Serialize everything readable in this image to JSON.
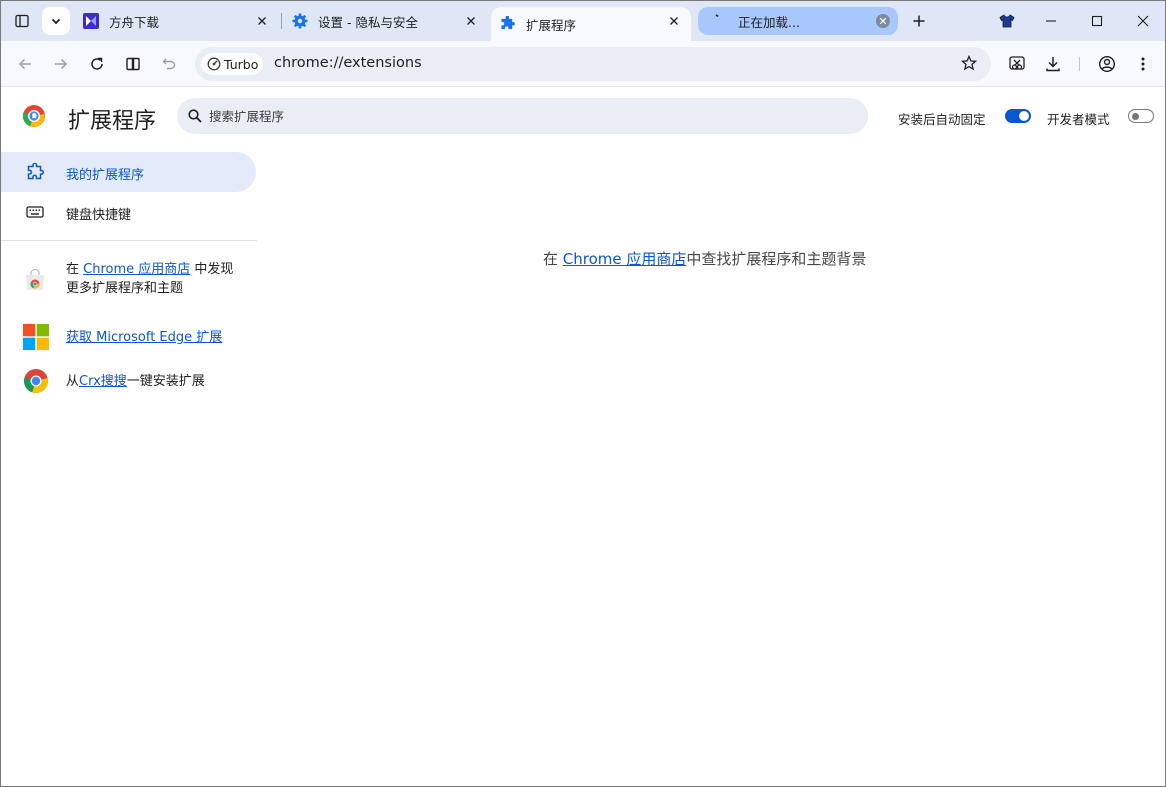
{
  "tabs": [
    {
      "title": "方舟下载",
      "icon": "fangzhou-icon",
      "active": false
    },
    {
      "title": "设置 - 隐私与安全",
      "icon": "gear-icon",
      "active": false
    },
    {
      "title": "扩展程序",
      "icon": "puzzle-icon",
      "active": true
    },
    {
      "title": "正在加载...",
      "icon": "loading-icon",
      "active": false,
      "loading": true
    }
  ],
  "toolbar": {
    "turbo_label": "Turbo",
    "url": "chrome://extensions"
  },
  "page": {
    "title": "扩展程序",
    "search_placeholder": "搜索扩展程序",
    "auto_pin_label": "安装后自动固定",
    "auto_pin_on": true,
    "dev_mode_label": "开发者模式",
    "dev_mode_on": false
  },
  "sidebar": {
    "items": [
      {
        "label": "我的扩展程序",
        "icon": "puzzle-outline-icon",
        "selected": true
      },
      {
        "label": "键盘快捷键",
        "icon": "keyboard-icon",
        "selected": false
      }
    ],
    "store_prefix": "在 ",
    "store_link": "Chrome 应用商店",
    "store_suffix": " 中发现更多扩展程序和主题",
    "edge_link": "获取 Microsoft Edge 扩展",
    "crx_prefix": "从",
    "crx_link": "Crx搜搜",
    "crx_suffix": "一键安装扩展"
  },
  "main": {
    "msg_prefix": "在 ",
    "msg_link": "Chrome 应用商店",
    "msg_suffix": "中查找扩展程序和主题背景"
  },
  "colors": {
    "accent": "#0b57d0",
    "tabstrip": "#dfe6f5",
    "loading_tab": "#a8c7fa"
  }
}
